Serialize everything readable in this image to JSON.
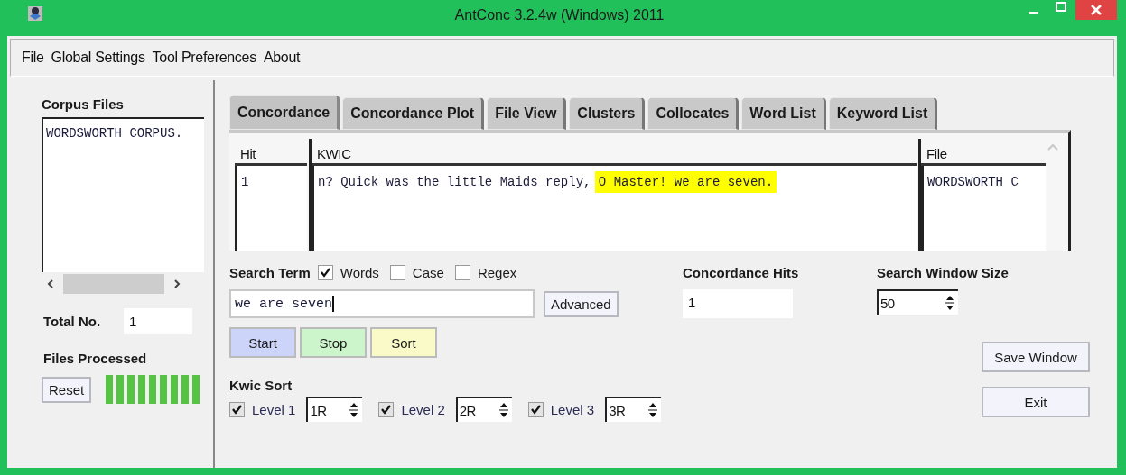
{
  "window": {
    "title": "AntConc 3.2.4w (Windows) 2011"
  },
  "menu": [
    "File",
    "Global Settings",
    "Tool Preferences",
    "About"
  ],
  "corpus": {
    "heading": "Corpus Files",
    "files": [
      "WORDSWORTH CORPUS."
    ],
    "total_label": "Total No.",
    "total": "1",
    "processed_label": "Files Processed",
    "progress": {
      "level": 1
    },
    "reset": "Reset"
  },
  "tabs": [
    {
      "label": "Concordance",
      "selected": true
    },
    {
      "label": "Concordance Plot",
      "selected": false
    },
    {
      "label": "File View",
      "selected": false
    },
    {
      "label": "Clusters",
      "selected": false
    },
    {
      "label": "Collocates",
      "selected": false
    },
    {
      "label": "Word List",
      "selected": false
    },
    {
      "label": "Keyword List",
      "selected": false
    }
  ],
  "table": {
    "columns": [
      "Hit",
      "KWIC",
      "File"
    ],
    "rows": [
      {
        "hit": "1",
        "left": "n? Quick was the little Maids reply, ",
        "match": "O Master! we are seven.",
        "file": "WORDSWORTH C"
      }
    ]
  },
  "search": {
    "label": "Search Term",
    "options": [
      {
        "label": "Words",
        "checked": true
      },
      {
        "label": "Case",
        "checked": false
      },
      {
        "label": "Regex",
        "checked": false
      }
    ],
    "value": "we are seven",
    "advanced": "Advanced",
    "buttons": [
      {
        "label": "Start",
        "color": "#ccd4fa"
      },
      {
        "label": "Stop",
        "color": "#ccf5cc"
      },
      {
        "label": "Sort",
        "color": "#fafac8"
      }
    ]
  },
  "hits": {
    "label": "Concordance Hits",
    "value": "1"
  },
  "window_size": {
    "label": "Search Window Size",
    "value": "50"
  },
  "kwic_sort": {
    "label": "Kwic Sort",
    "levels": [
      {
        "label": "Level 1",
        "checked": true,
        "value": "1R"
      },
      {
        "label": "Level 2",
        "checked": true,
        "value": "2R"
      },
      {
        "label": "Level 3",
        "checked": true,
        "value": "3R"
      }
    ]
  },
  "save": "Save Window",
  "exit": "Exit"
}
